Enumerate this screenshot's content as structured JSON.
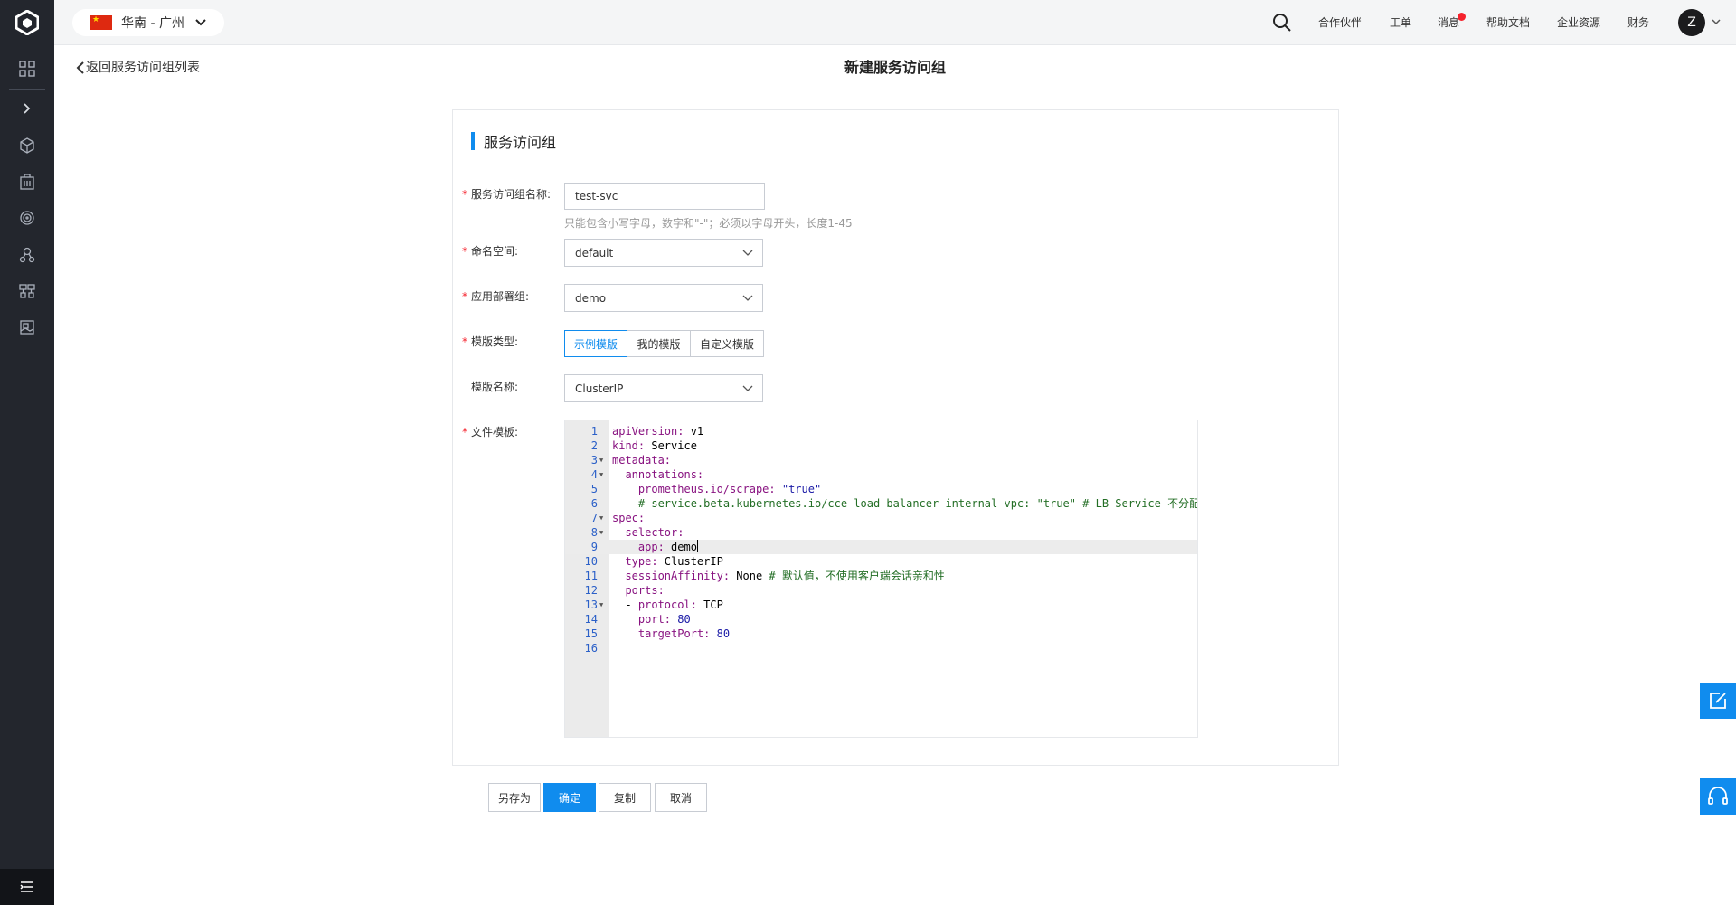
{
  "header": {
    "region_label": "华南 - 广州",
    "links": [
      "合作伙伴",
      "工单",
      "消息",
      "帮助文档",
      "企业资源",
      "财务"
    ],
    "avatar_letter": "Z"
  },
  "subheader": {
    "back_label": "返回服务访问组列表",
    "title": "新建服务访问组"
  },
  "section": {
    "title": "服务访问组"
  },
  "form": {
    "name_label": "服务访问组名称:",
    "name_value": "test-svc",
    "name_hint": "只能包含小写字母，数字和\"-\"；必须以字母开头，长度1-45",
    "namespace_label": "命名空间:",
    "namespace_value": "default",
    "deploy_group_label": "应用部署组:",
    "deploy_group_value": "demo",
    "template_type_label": "模版类型:",
    "template_types": [
      "示例模版",
      "我的模版",
      "自定义模版"
    ],
    "template_name_label": "模版名称:",
    "template_name_value": "ClusterIP",
    "file_template_label": "文件模板:"
  },
  "editor": {
    "lines": [
      {
        "n": "1",
        "tokens": [
          {
            "t": "apiVersion:",
            "c": "k"
          },
          {
            "t": " v1",
            "c": ""
          }
        ]
      },
      {
        "n": "2",
        "tokens": [
          {
            "t": "kind:",
            "c": "k"
          },
          {
            "t": " Service",
            "c": ""
          }
        ]
      },
      {
        "n": "3",
        "fold": true,
        "tokens": [
          {
            "t": "metadata:",
            "c": "k"
          }
        ]
      },
      {
        "n": "4",
        "fold": true,
        "tokens": [
          {
            "t": "  annotations:",
            "c": "k"
          }
        ]
      },
      {
        "n": "5",
        "tokens": [
          {
            "t": "    prometheus.io/scrape:",
            "c": "k"
          },
          {
            "t": " \"true\"",
            "c": "s"
          }
        ]
      },
      {
        "n": "6",
        "tokens": [
          {
            "t": "    # service.beta.kubernetes.io/cce-load-balancer-internal-vpc: \"true\" # LB Service 不分配公网IP",
            "c": "c"
          }
        ]
      },
      {
        "n": "7",
        "fold": true,
        "tokens": [
          {
            "t": "spec:",
            "c": "k"
          }
        ]
      },
      {
        "n": "8",
        "fold": true,
        "tokens": [
          {
            "t": "  selector:",
            "c": "k"
          }
        ]
      },
      {
        "n": "9",
        "active": true,
        "tokens": [
          {
            "t": "    app:",
            "c": "k"
          },
          {
            "t": " demo",
            "c": ""
          }
        ]
      },
      {
        "n": "10",
        "tokens": [
          {
            "t": "  type:",
            "c": "k"
          },
          {
            "t": " ClusterIP",
            "c": ""
          }
        ]
      },
      {
        "n": "11",
        "tokens": [
          {
            "t": "  sessionAffinity:",
            "c": "k"
          },
          {
            "t": " None",
            "c": ""
          },
          {
            "t": " # 默认值，不使用客户端会话亲和性",
            "c": "c"
          }
        ]
      },
      {
        "n": "12",
        "tokens": [
          {
            "t": "  ports:",
            "c": "k"
          }
        ]
      },
      {
        "n": "13",
        "fold": true,
        "tokens": [
          {
            "t": "  - ",
            "c": ""
          },
          {
            "t": "protocol:",
            "c": "k"
          },
          {
            "t": " TCP",
            "c": ""
          }
        ]
      },
      {
        "n": "14",
        "tokens": [
          {
            "t": "    port:",
            "c": "k"
          },
          {
            "t": " 80",
            "c": "n"
          }
        ]
      },
      {
        "n": "15",
        "tokens": [
          {
            "t": "    targetPort:",
            "c": "k"
          },
          {
            "t": " 80",
            "c": "n"
          }
        ]
      },
      {
        "n": "16",
        "tokens": []
      }
    ]
  },
  "actions": {
    "save_as": "另存为",
    "confirm": "确定",
    "copy": "复制",
    "cancel": "取消"
  },
  "icons": {
    "logo": "cube-logo-icon",
    "sidebar": [
      "grid-icon",
      "chevron-right-icon",
      "cube-icon",
      "building-icon",
      "target-icon",
      "users-icon",
      "cluster-icon",
      "image-icon"
    ],
    "bottom": "menu-icon",
    "float": [
      "edit-icon",
      "headset-icon"
    ]
  },
  "colors": {
    "accent": "#108cee",
    "sidebar_bg": "#23262d",
    "required": "#f5222d"
  }
}
